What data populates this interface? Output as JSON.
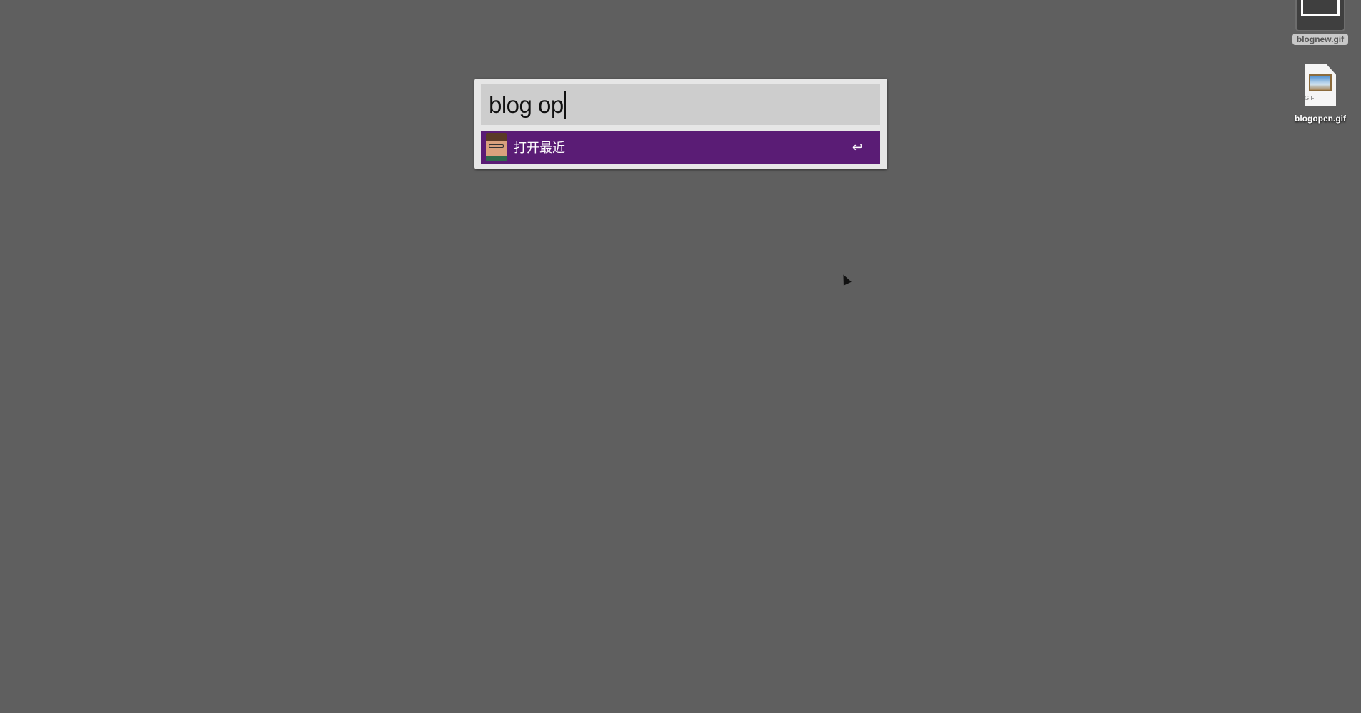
{
  "launcher": {
    "query": "blog op",
    "results": [
      {
        "label": "打开最近",
        "action_icon": "return-key-icon",
        "action_glyph": "↩"
      }
    ],
    "accent": "#5a1c75"
  },
  "desktop": {
    "icons": [
      {
        "label": "blognew.gif",
        "selected": true
      },
      {
        "label": "blogopen.gif",
        "ext": "GIF",
        "selected": false
      }
    ]
  }
}
